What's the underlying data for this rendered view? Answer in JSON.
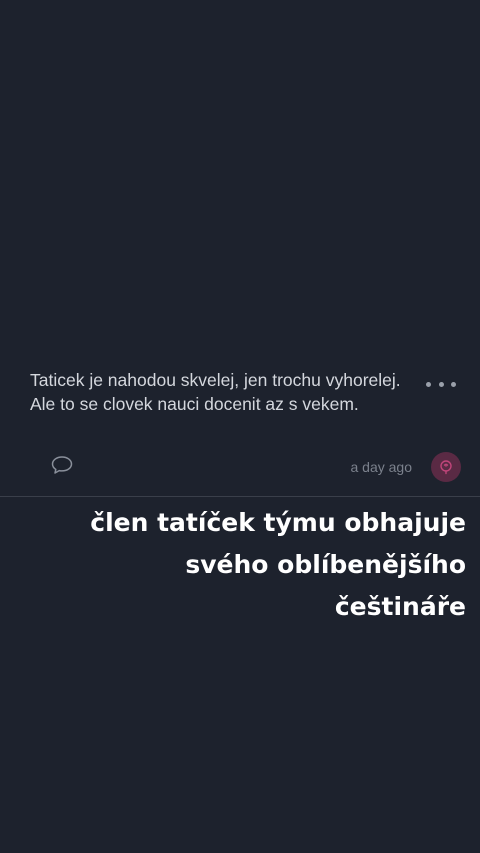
{
  "comment": {
    "text": "Taticek je nahodou skvelej, jen trochu vyhorelej. Ale to se clovek nauci docenit az s vekem.",
    "timestamp": "a day ago",
    "reply_icon": "speech-bubble-icon",
    "more_icon": "more-horizontal-icon",
    "avatar_icon": "user-avatar-icon",
    "avatar_color": "#5a2a44",
    "avatar_accent": "#c0457a"
  },
  "caption": {
    "lines": [
      "člen tatíček týmu obhajuje",
      "svého oblíbenějšího",
      "češtináře"
    ]
  },
  "colors": {
    "background": "#1d222d",
    "text": "#d4d7dd",
    "muted": "#7b818c",
    "caption": "#ffffff"
  }
}
